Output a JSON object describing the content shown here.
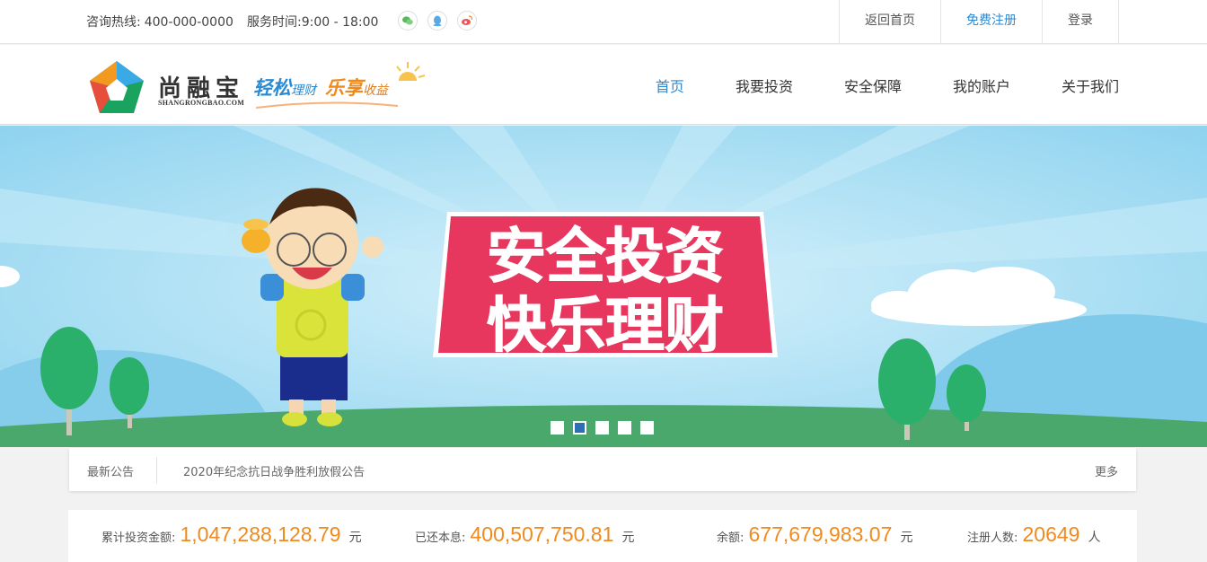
{
  "topbar": {
    "hotline_label": "咨询热线:",
    "hotline_number": "400-000-0000",
    "service_label": "服务时间:",
    "service_hours": "9:00 - 18:00",
    "links": [
      "返回首页",
      "免费注册",
      "登录"
    ]
  },
  "header": {
    "brand_name": "尚融宝",
    "brand_sub": "SHANGRONGBAO.COM",
    "slogan_a": "轻松",
    "slogan_a_small": "理财",
    "slogan_b": "乐享",
    "slogan_b_small": "收益",
    "nav": [
      "首页",
      "我要投资",
      "安全保障",
      "我的账户",
      "关于我们"
    ]
  },
  "banner": {
    "headline_1": "安全投资",
    "headline_2": "快乐理财",
    "slide_count": 5,
    "active_slide": 2
  },
  "notice": {
    "label": "最新公告",
    "text": "2020年纪念抗日战争胜利放假公告",
    "more": "更多"
  },
  "stats": {
    "total_label": "累计投资金额:",
    "total_value": "1,047,288,128.79",
    "total_unit": "元",
    "repaid_label": "已还本息:",
    "repaid_value": "400,507,750.81",
    "repaid_unit": "元",
    "balance_label": "余额:",
    "balance_value": "677,679,983.07",
    "balance_unit": "元",
    "users_label": "注册人数:",
    "users_value": "20649",
    "users_unit": "人"
  },
  "colors": {
    "accent_blue": "#2a8ad3",
    "accent_orange": "#f08a1c",
    "banner_pink": "#e8375e"
  }
}
